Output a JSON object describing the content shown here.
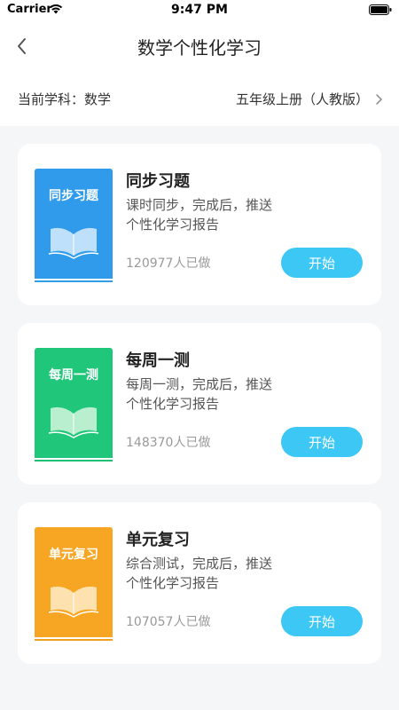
{
  "status_bar": {
    "carrier": "Carrier",
    "time": "9:47 PM"
  },
  "nav": {
    "title": "数学个性化学习",
    "back_icon": "chevron-left-icon"
  },
  "subject_bar": {
    "current_subject": "当前学科：数学",
    "grade": "五年级上册（人教版）"
  },
  "cards": [
    {
      "book_label": "同步习题",
      "book_color": "#2f9bea",
      "book_base_color": "#2fa0e8",
      "book_icon_color": "#bfe0fb",
      "title": "同步习题",
      "desc_line1": "课时同步，完成后，推送",
      "desc_line2": "个性化学习报告",
      "count": "120977人已做",
      "button": "开始"
    },
    {
      "book_label": "每周一测",
      "book_color": "#20c77a",
      "book_base_color": "#1fbf74",
      "book_icon_color": "#b9efcf",
      "title": "每周一测",
      "desc_line1": "每周一测，完成后，推送",
      "desc_line2": "个性化学习报告",
      "count": "148370人已做",
      "button": "开始"
    },
    {
      "book_label": "单元复习",
      "book_color": "#f6a623",
      "book_base_color": "#f0a020",
      "book_icon_color": "#fde2b0",
      "title": "单元复习",
      "desc_line1": "综合测试，完成后，推送",
      "desc_line2": "个性化学习报告",
      "count": "107057人已做",
      "button": "开始"
    }
  ]
}
